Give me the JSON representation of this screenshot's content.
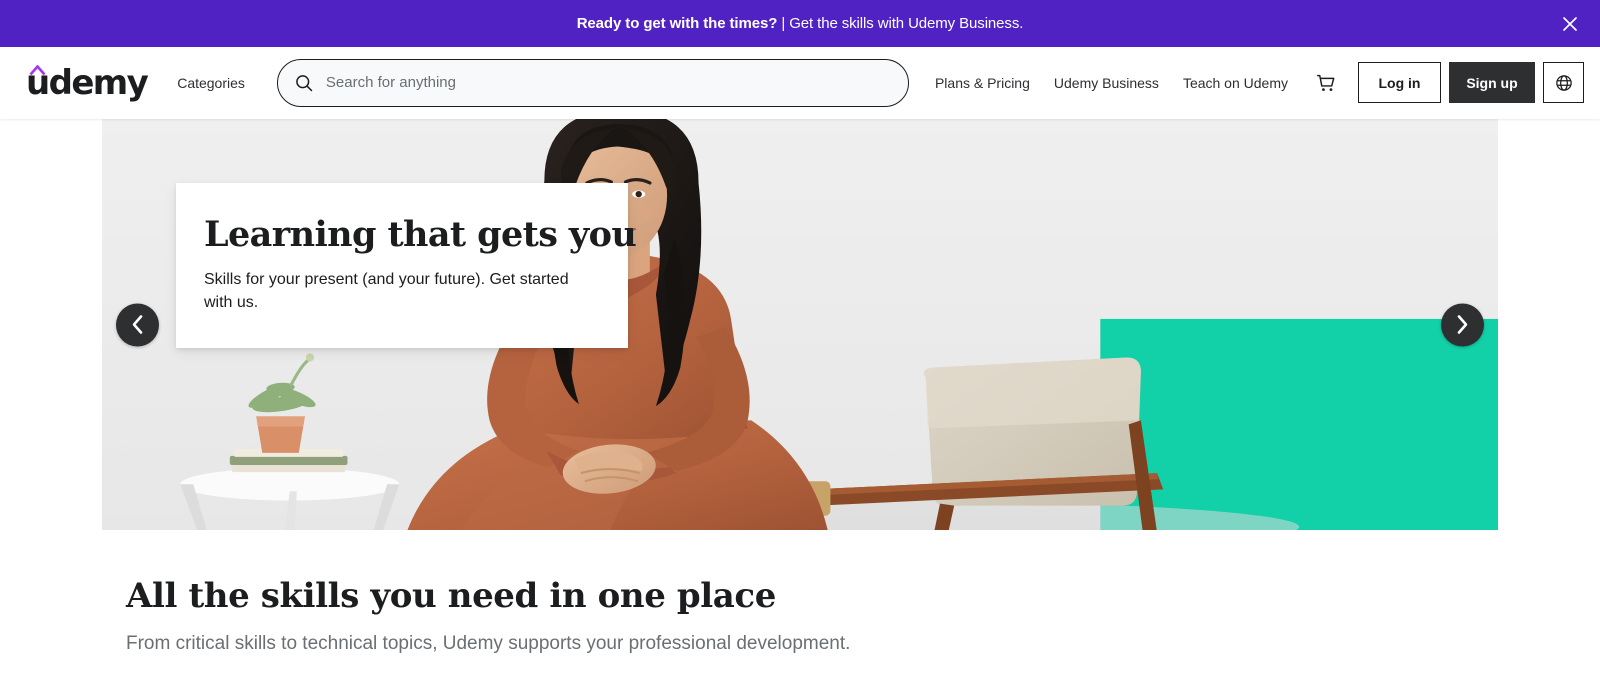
{
  "promo": {
    "bold_text": "Ready to get with the times?",
    "rest_text": " | Get the skills with Udemy Business.",
    "close_label": "✕",
    "background_color": "#5022c3"
  },
  "header": {
    "logo_text": "udemy",
    "logo_accent_color": "#a435f0",
    "categories_label": "Categories",
    "search": {
      "placeholder": "Search for anything",
      "value": ""
    },
    "nav_links": [
      {
        "label": "Plans & Pricing"
      },
      {
        "label": "Udemy Business"
      },
      {
        "label": "Teach on Udemy"
      }
    ],
    "cart_icon": "shopping-cart-icon",
    "login_label": "Log in",
    "signup_label": "Sign up",
    "language_icon": "globe-icon"
  },
  "hero": {
    "title": "Learning that gets you",
    "subtitle": "Skills for your present (and your future). Get started with us.",
    "prev_label": "‹",
    "next_label": "›",
    "background_color": "#ececec",
    "accent_color": "#12d1a8"
  },
  "section": {
    "title": "All the skills you need in one place",
    "subtitle": "From critical skills to technical topics, Udemy supports your professional development."
  }
}
